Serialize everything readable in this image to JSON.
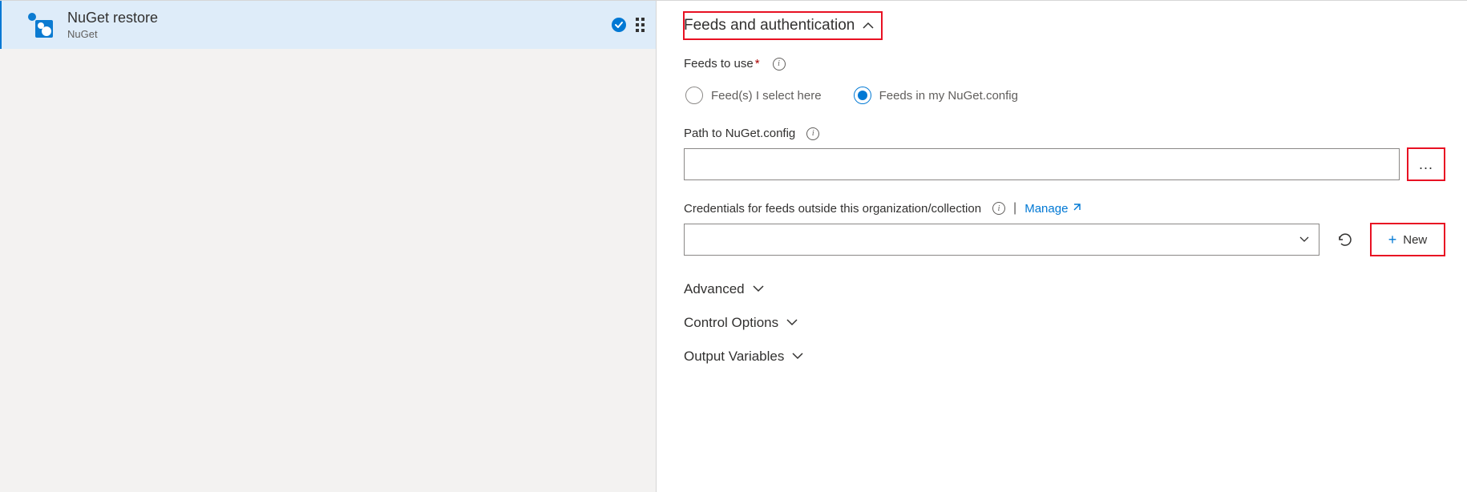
{
  "task": {
    "title": "NuGet restore",
    "subtitle": "NuGet"
  },
  "section": {
    "title": "Feeds and authentication",
    "feeds_to_use_label": "Feeds to use",
    "radio_select_here": "Feed(s) I select here",
    "radio_nuget_config": "Feeds in my NuGet.config",
    "path_label": "Path to NuGet.config",
    "path_value": "",
    "browse_label": "...",
    "credentials_label": "Credentials for feeds outside this organization/collection",
    "manage_label": "Manage",
    "new_label": "New",
    "select_value": ""
  },
  "subsections": {
    "advanced": "Advanced",
    "control_options": "Control Options",
    "output_variables": "Output Variables"
  }
}
